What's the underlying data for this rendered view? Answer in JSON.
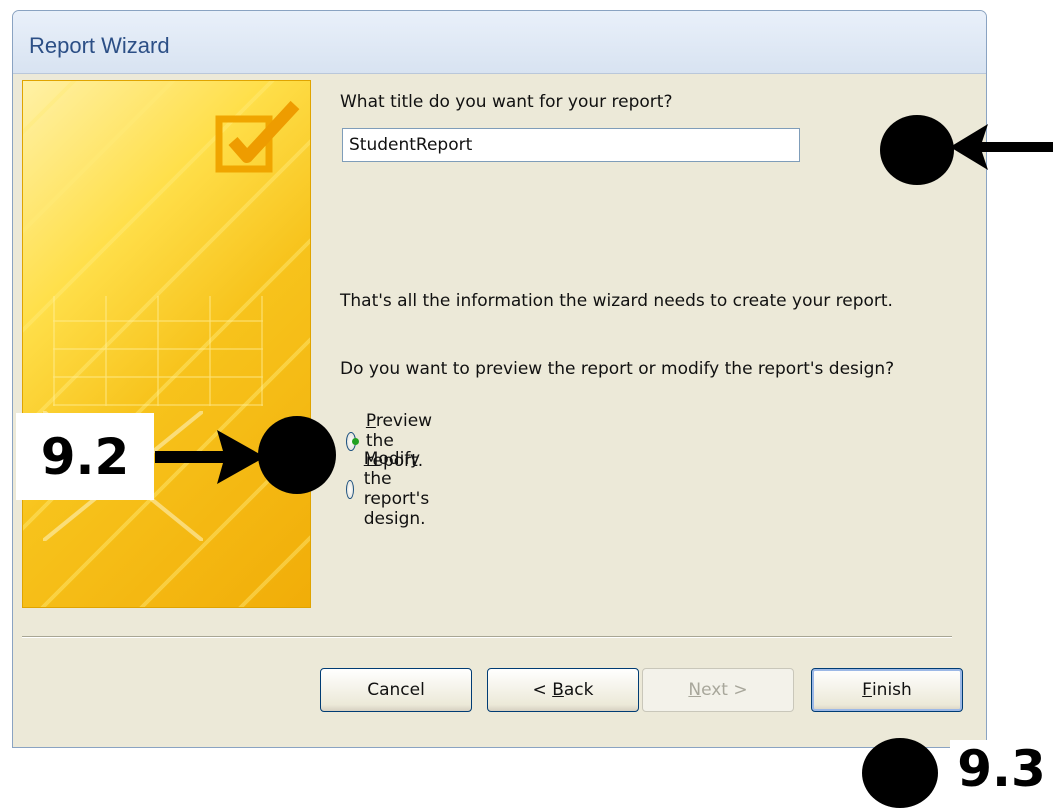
{
  "window": {
    "title": "Report Wizard"
  },
  "question_title": "What title do you want for your report?",
  "report_title_value": "StudentReport",
  "info_text": "That's all the information the wizard needs to create your report.",
  "question_preview": "Do you want to preview the report or modify the report's design?",
  "options": {
    "preview": {
      "underline": "P",
      "rest": "review the report.",
      "checked": true
    },
    "modify": {
      "underline": "M",
      "rest": "odify the report's design.",
      "checked": false
    }
  },
  "buttons": {
    "cancel": "Cancel",
    "back_prefix": "< ",
    "back_underline": "B",
    "back_rest": "ack",
    "next_underline": "N",
    "next_rest": "ext >",
    "finish_underline": "F",
    "finish_rest": "inish"
  },
  "annotations": {
    "label_a": "9.2",
    "label_b": "9.3"
  },
  "colors": {
    "accent_radio": "#21a121",
    "banner": "#f7c31c",
    "annotation": "#000000"
  }
}
